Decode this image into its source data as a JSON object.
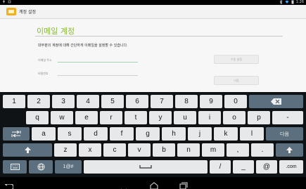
{
  "status_bar": {
    "time": "1:26"
  },
  "action_bar": {
    "title": "계정 설정"
  },
  "setup": {
    "title": "이메일 계정",
    "description": "대부분의 계정에 대해 간단하게 이메일을 설정할 수 있습니다.",
    "email_label": "이메일 주소",
    "password_label": "비밀번호",
    "manual_setup_button": "수동 설정",
    "next_button": "다음"
  },
  "keyboard": {
    "row1": [
      "1",
      "2",
      "3",
      "4",
      "5",
      "6",
      "7",
      "8",
      "9",
      "0"
    ],
    "row2": [
      "q",
      "w",
      "e",
      "r",
      "t",
      "y",
      "u",
      "i",
      "o",
      "p",
      "-"
    ],
    "row3": [
      "a",
      "s",
      "d",
      "f",
      "g",
      "h",
      "j",
      "k",
      "l"
    ],
    "next_key": "다음",
    "row4": [
      "z",
      "x",
      "c",
      "v",
      "b",
      "n",
      "m",
      ",",
      "."
    ],
    "row5": {
      "symbols": "1@#",
      "slash": "/",
      "underscore": "_",
      "at": "@",
      "dotcom": ".com"
    }
  },
  "colors": {
    "accent_green": "#8bb83c",
    "key_light": "#e6e8ea",
    "key_dark": "#5c6f7e",
    "keyboard_bg": "#101316"
  }
}
